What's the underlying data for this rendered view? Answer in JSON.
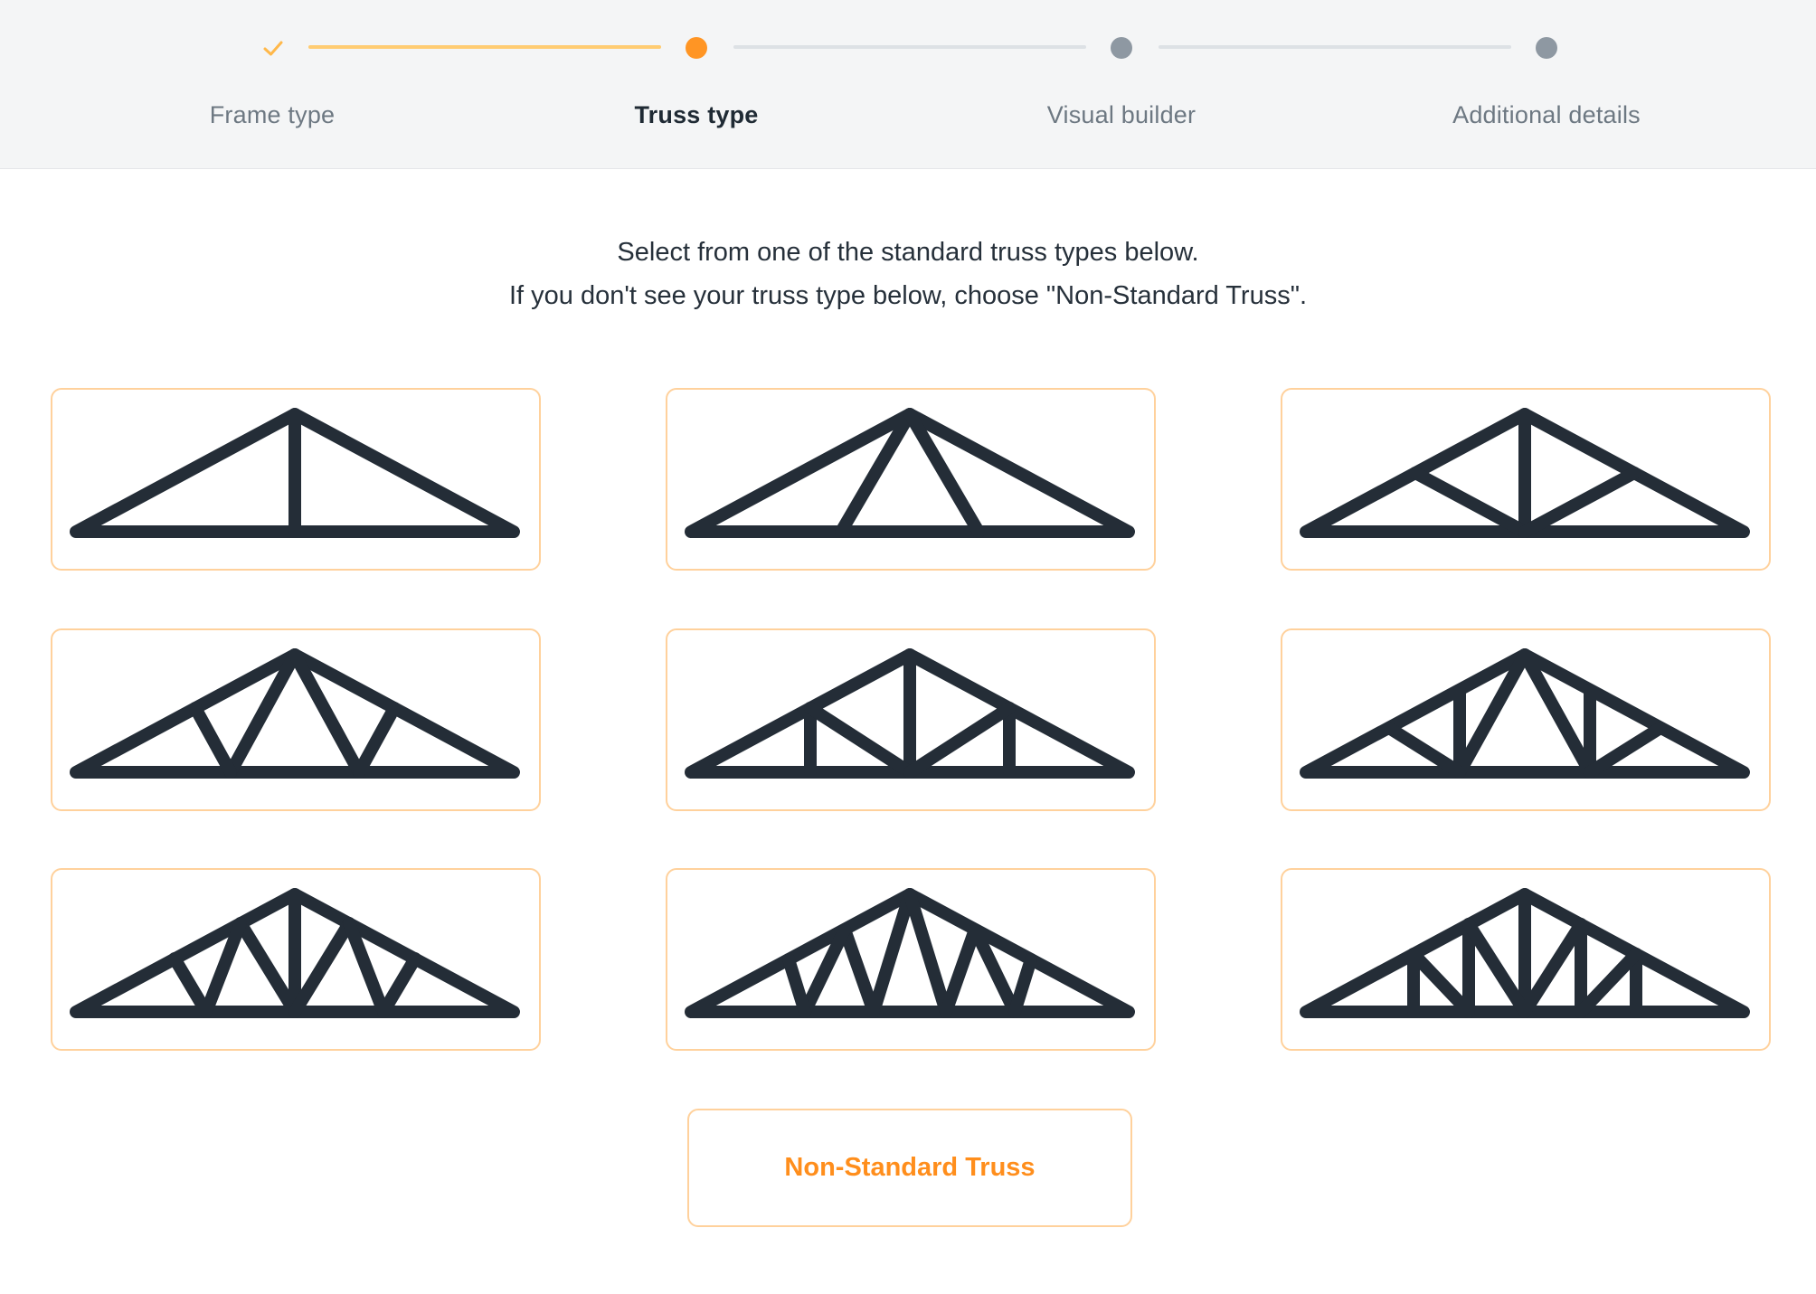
{
  "stepper": {
    "steps": [
      {
        "label": "Frame type",
        "state": "completed",
        "icon": "check-icon"
      },
      {
        "label": "Truss type",
        "state": "current",
        "icon": "dot-icon"
      },
      {
        "label": "Visual builder",
        "state": "upcoming",
        "icon": "dot-icon"
      },
      {
        "label": "Additional details",
        "state": "upcoming",
        "icon": "dot-icon"
      }
    ]
  },
  "intro": {
    "line1": "Select from one of the standard truss types below.",
    "line2": "If you don't see your truss type below, choose \"Non-Standard Truss\"."
  },
  "truss_options": [
    {
      "icon": "king-post-truss-icon"
    },
    {
      "icon": "fink-a-truss-icon"
    },
    {
      "icon": "king-post-diagonal-truss-icon"
    },
    {
      "icon": "fink-w-truss-icon"
    },
    {
      "icon": "howe-truss-icon"
    },
    {
      "icon": "fan-w-truss-icon"
    },
    {
      "icon": "double-fink-truss-icon"
    },
    {
      "icon": "triple-fink-truss-icon"
    },
    {
      "icon": "double-howe-truss-icon"
    }
  ],
  "non_standard_button": {
    "label": "Non-Standard Truss"
  },
  "colors": {
    "accent": "#ff9524",
    "accent_light": "#ffcc72",
    "card_border": "#ffd19c",
    "truss_stroke": "#242d37",
    "step_inactive": "#8e98a2",
    "background_header": "#f4f5f6"
  }
}
